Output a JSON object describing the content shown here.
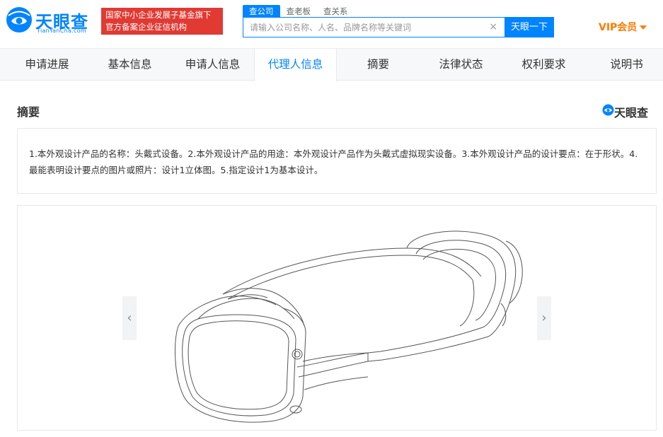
{
  "header": {
    "logo_text": "天眼查",
    "logo_sub": "TianYanCha.com",
    "badge_line1": "国家中小企业发展子基金旗下",
    "badge_line2": "官方备案企业征信机构",
    "search_tabs": [
      "查公司",
      "查老板",
      "查关系"
    ],
    "search_placeholder": "请输入公司名称、人名、品牌名称等关键词",
    "search_clear": "×",
    "search_button": "天眼一下",
    "vip_label": "VIP会员"
  },
  "nav": {
    "tabs": [
      "申请进展",
      "基本信息",
      "申请人信息",
      "代理人信息",
      "摘要",
      "法律状态",
      "权利要求",
      "说明书"
    ],
    "active_index": 3
  },
  "section": {
    "title": "摘要",
    "watermark": "天眼查"
  },
  "abstract": {
    "text": "1.本外观设计产品的名称：头戴式设备。2.本外观设计产品的用途：本外观设计产品作为头戴式虚拟现实设备。3.本外观设计产品的设计要点：在于形状。4.最能表明设计要点的图片或照片：设计1立体图。5.指定设计1为基本设计。"
  },
  "gallery": {
    "prev_label": "‹",
    "next_label": "›"
  },
  "colors": {
    "brand_blue": "#0084ff",
    "badge_red": "#e03a33",
    "vip_orange": "#ff7a00"
  }
}
